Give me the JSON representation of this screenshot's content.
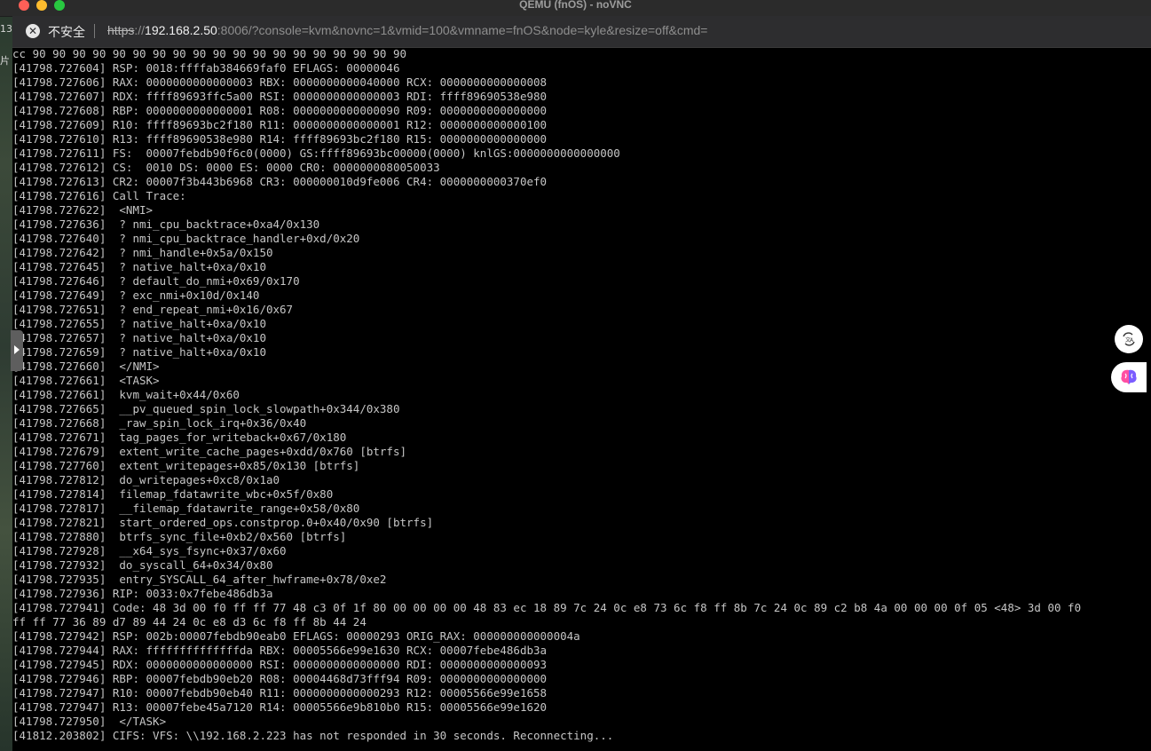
{
  "window": {
    "title": "QEMU (fnOS) - noVNC"
  },
  "address_bar": {
    "security_label": "不安全",
    "url_scheme": "https",
    "url_sep": "://",
    "url_host": "192.168.2.50",
    "url_rest": ":8006/?console=kvm&novnc=1&vmid=100&vmname=fnOS&node=kyle&resize=off&cmd="
  },
  "desktop_fragments": [
    "13",
    "片"
  ],
  "console": {
    "lines": [
      "cc 90 90 90 90 90 90 90 90 90 90 90 90 90 90 90 90 90 90 90",
      "[41798.727604] RSP: 0018:ffffab384669faf0 EFLAGS: 00000046",
      "[41798.727606] RAX: 0000000000000003 RBX: 0000000000040000 RCX: 0000000000000008",
      "[41798.727607] RDX: ffff89693ffc5a00 RSI: 0000000000000003 RDI: ffff89690538e980",
      "[41798.727608] RBP: 0000000000000001 R08: 0000000000000090 R09: 0000000000000000",
      "[41798.727609] R10: ffff89693bc2f180 R11: 0000000000000001 R12: 0000000000000100",
      "[41798.727610] R13: ffff89690538e980 R14: ffff89693bc2f180 R15: 0000000000000000",
      "[41798.727611] FS:  00007febdb90f6c0(0000) GS:ffff89693bc00000(0000) knlGS:0000000000000000",
      "[41798.727612] CS:  0010 DS: 0000 ES: 0000 CR0: 0000000080050033",
      "[41798.727613] CR2: 00007f3b443b6968 CR3: 000000010d9fe006 CR4: 0000000000370ef0",
      "[41798.727616] Call Trace:",
      "[41798.727622]  <NMI>",
      "[41798.727636]  ? nmi_cpu_backtrace+0xa4/0x130",
      "[41798.727640]  ? nmi_cpu_backtrace_handler+0xd/0x20",
      "[41798.727642]  ? nmi_handle+0x5a/0x150",
      "[41798.727645]  ? native_halt+0xa/0x10",
      "[41798.727646]  ? default_do_nmi+0x69/0x170",
      "[41798.727649]  ? exc_nmi+0x10d/0x140",
      "[41798.727651]  ? end_repeat_nmi+0x16/0x67",
      "[41798.727655]  ? native_halt+0xa/0x10",
      "[41798.727657]  ? native_halt+0xa/0x10",
      "[41798.727659]  ? native_halt+0xa/0x10",
      "[41798.727660]  </NMI>",
      "[41798.727661]  <TASK>",
      "[41798.727661]  kvm_wait+0x44/0x60",
      "[41798.727665]  __pv_queued_spin_lock_slowpath+0x344/0x380",
      "[41798.727668]  _raw_spin_lock_irq+0x36/0x40",
      "[41798.727671]  tag_pages_for_writeback+0x67/0x180",
      "[41798.727679]  extent_write_cache_pages+0xdd/0x760 [btrfs]",
      "[41798.727760]  extent_writepages+0x85/0x130 [btrfs]",
      "[41798.727812]  do_writepages+0xc8/0x1a0",
      "[41798.727814]  filemap_fdatawrite_wbc+0x5f/0x80",
      "[41798.727817]  __filemap_fdatawrite_range+0x58/0x80",
      "[41798.727821]  start_ordered_ops.constprop.0+0x40/0x90 [btrfs]",
      "[41798.727880]  btrfs_sync_file+0xb2/0x560 [btrfs]",
      "[41798.727928]  __x64_sys_fsync+0x37/0x60",
      "[41798.727932]  do_syscall_64+0x34/0x80",
      "[41798.727935]  entry_SYSCALL_64_after_hwframe+0x78/0xe2",
      "[41798.727936] RIP: 0033:0x7febe486db3a",
      "[41798.727941] Code: 48 3d 00 f0 ff ff 77 48 c3 0f 1f 80 00 00 00 00 48 83 ec 18 89 7c 24 0c e8 73 6c f8 ff 8b 7c 24 0c 89 c2 b8 4a 00 00 00 0f 05 <48> 3d 00 f0",
      "ff ff 77 36 89 d7 89 44 24 0c e8 d3 6c f8 ff 8b 44 24",
      "[41798.727942] RSP: 002b:00007febdb90eab0 EFLAGS: 00000293 ORIG_RAX: 000000000000004a",
      "[41798.727944] RAX: ffffffffffffffda RBX: 00005566e99e1630 RCX: 00007febe486db3a",
      "[41798.727945] RDX: 0000000000000000 RSI: 0000000000000000 RDI: 0000000000000093",
      "[41798.727946] RBP: 00007febdb90eb20 R08: 00004468d73fff94 R09: 0000000000000000",
      "[41798.727947] R10: 00007febdb90eb40 R11: 0000000000000293 R12: 00005566e99e1658",
      "[41798.727947] R13: 00007febe45a7120 R14: 00005566e9b810b0 R15: 00005566e99e1620",
      "[41798.727950]  </TASK>",
      "[41812.203802] CIFS: VFS: \\\\192.168.2.223 has not responded in 30 seconds. Reconnecting..."
    ]
  },
  "icons": {
    "insecure": "close-circle-icon",
    "translate": "translate-icon",
    "ai_assistant": "brain-icon",
    "sidebar_toggle": "chevron-right-icon"
  }
}
